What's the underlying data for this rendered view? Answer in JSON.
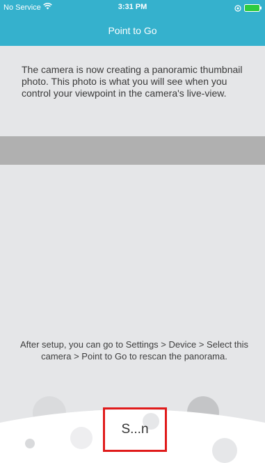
{
  "status_bar": {
    "carrier": "No Service",
    "time": "3:31 PM"
  },
  "nav": {
    "title": "Point to Go"
  },
  "intro_text": "The camera is now creating a panoramic thumbnail photo. This photo is what you will see when you control your viewpoint in the camera's live-view.",
  "hint_text": "After setup, you can go to Settings > Device > Select this camera > Point to Go to rescan the panorama.",
  "scan_button_label": "S...n",
  "colors": {
    "nav_background": "#35b1cd",
    "page_background": "#e5e6e8",
    "thumbnail_strip": "#b0b0b0",
    "highlight_border": "#e01b1b"
  },
  "icons": [
    "wifi-icon",
    "location-icon",
    "battery-icon"
  ]
}
